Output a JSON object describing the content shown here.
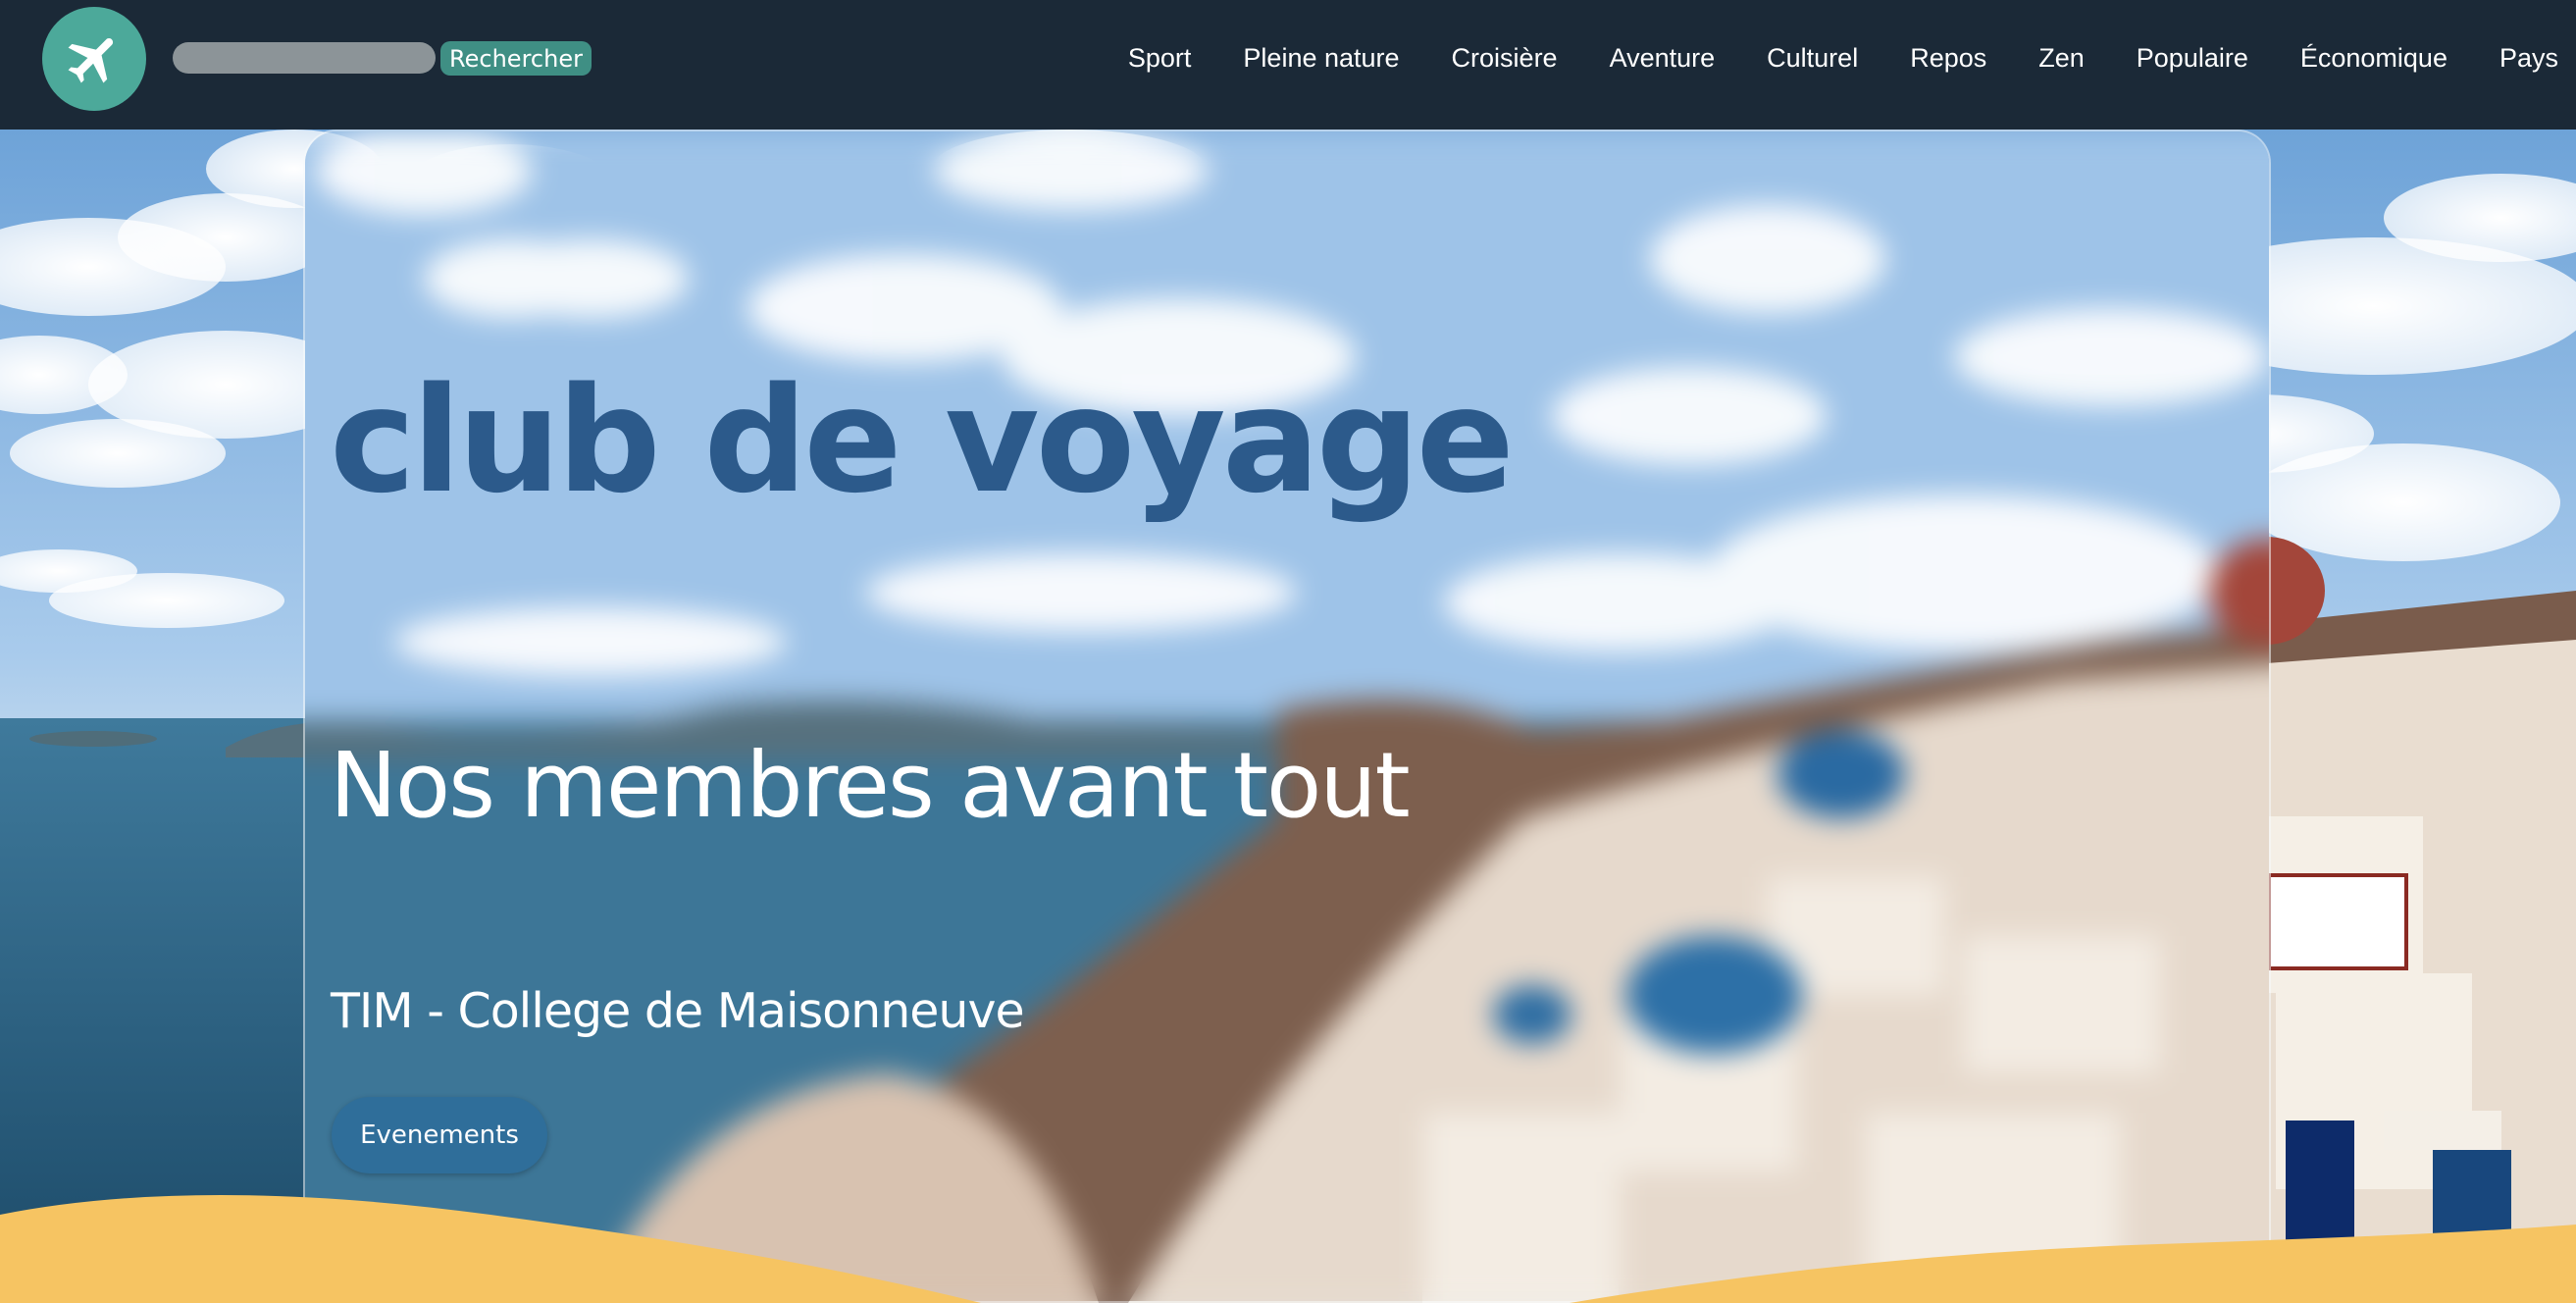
{
  "header": {
    "logo_icon": "airplane-icon",
    "search": {
      "placeholder": "",
      "button_label": "Rechercher"
    },
    "nav": [
      {
        "label": "Sport"
      },
      {
        "label": "Pleine nature"
      },
      {
        "label": "Croisière"
      },
      {
        "label": "Aventure"
      },
      {
        "label": "Culturel"
      },
      {
        "label": "Repos"
      },
      {
        "label": "Zen"
      },
      {
        "label": "Populaire"
      },
      {
        "label": "Économique"
      },
      {
        "label": "Pays"
      }
    ]
  },
  "hero": {
    "title": "club de voyage",
    "subtitle": "Nos membres avant tout",
    "school": "TIM - College de Maisonneuve",
    "events_button": "Evenements"
  },
  "colors": {
    "header_bg": "#1b2937",
    "logo_bg": "#4ca99a",
    "search_button_bg": "#3f8f84",
    "title_color": "#2c5a8b",
    "button_bg": "#2f6e9a",
    "wave_color": "#f6c462"
  }
}
